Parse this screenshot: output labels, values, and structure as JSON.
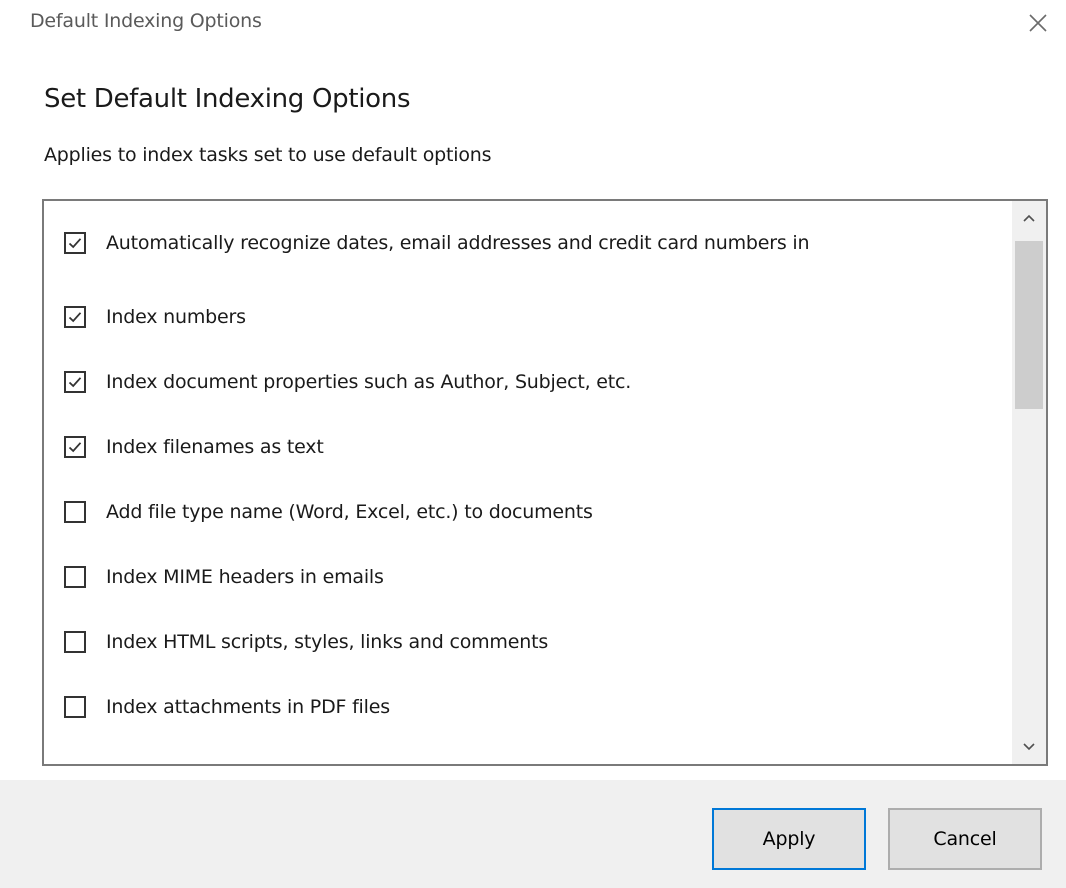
{
  "window": {
    "title": "Default Indexing Options",
    "close_icon": "close-icon"
  },
  "main": {
    "heading": "Set Default Indexing Options",
    "subheading": "Applies to index tasks set to use default options"
  },
  "options": [
    {
      "label": "Automatically recognize dates, email addresses and credit card numbers in",
      "checked": true
    },
    {
      "label": "Index numbers",
      "checked": true
    },
    {
      "label": "Index document properties such as Author, Subject, etc.",
      "checked": true
    },
    {
      "label": "Index filenames as text",
      "checked": true
    },
    {
      "label": "Add file type name (Word, Excel, etc.) to documents",
      "checked": false
    },
    {
      "label": "Index MIME headers in emails",
      "checked": false
    },
    {
      "label": "Index HTML scripts, styles, links and comments",
      "checked": false
    },
    {
      "label": "Index attachments in PDF files",
      "checked": false
    }
  ],
  "buttons": {
    "apply": "Apply",
    "cancel": "Cancel"
  },
  "colors": {
    "accent": "#0078d7",
    "footer_bg": "#f0f0f0",
    "button_bg": "#e1e1e1"
  }
}
